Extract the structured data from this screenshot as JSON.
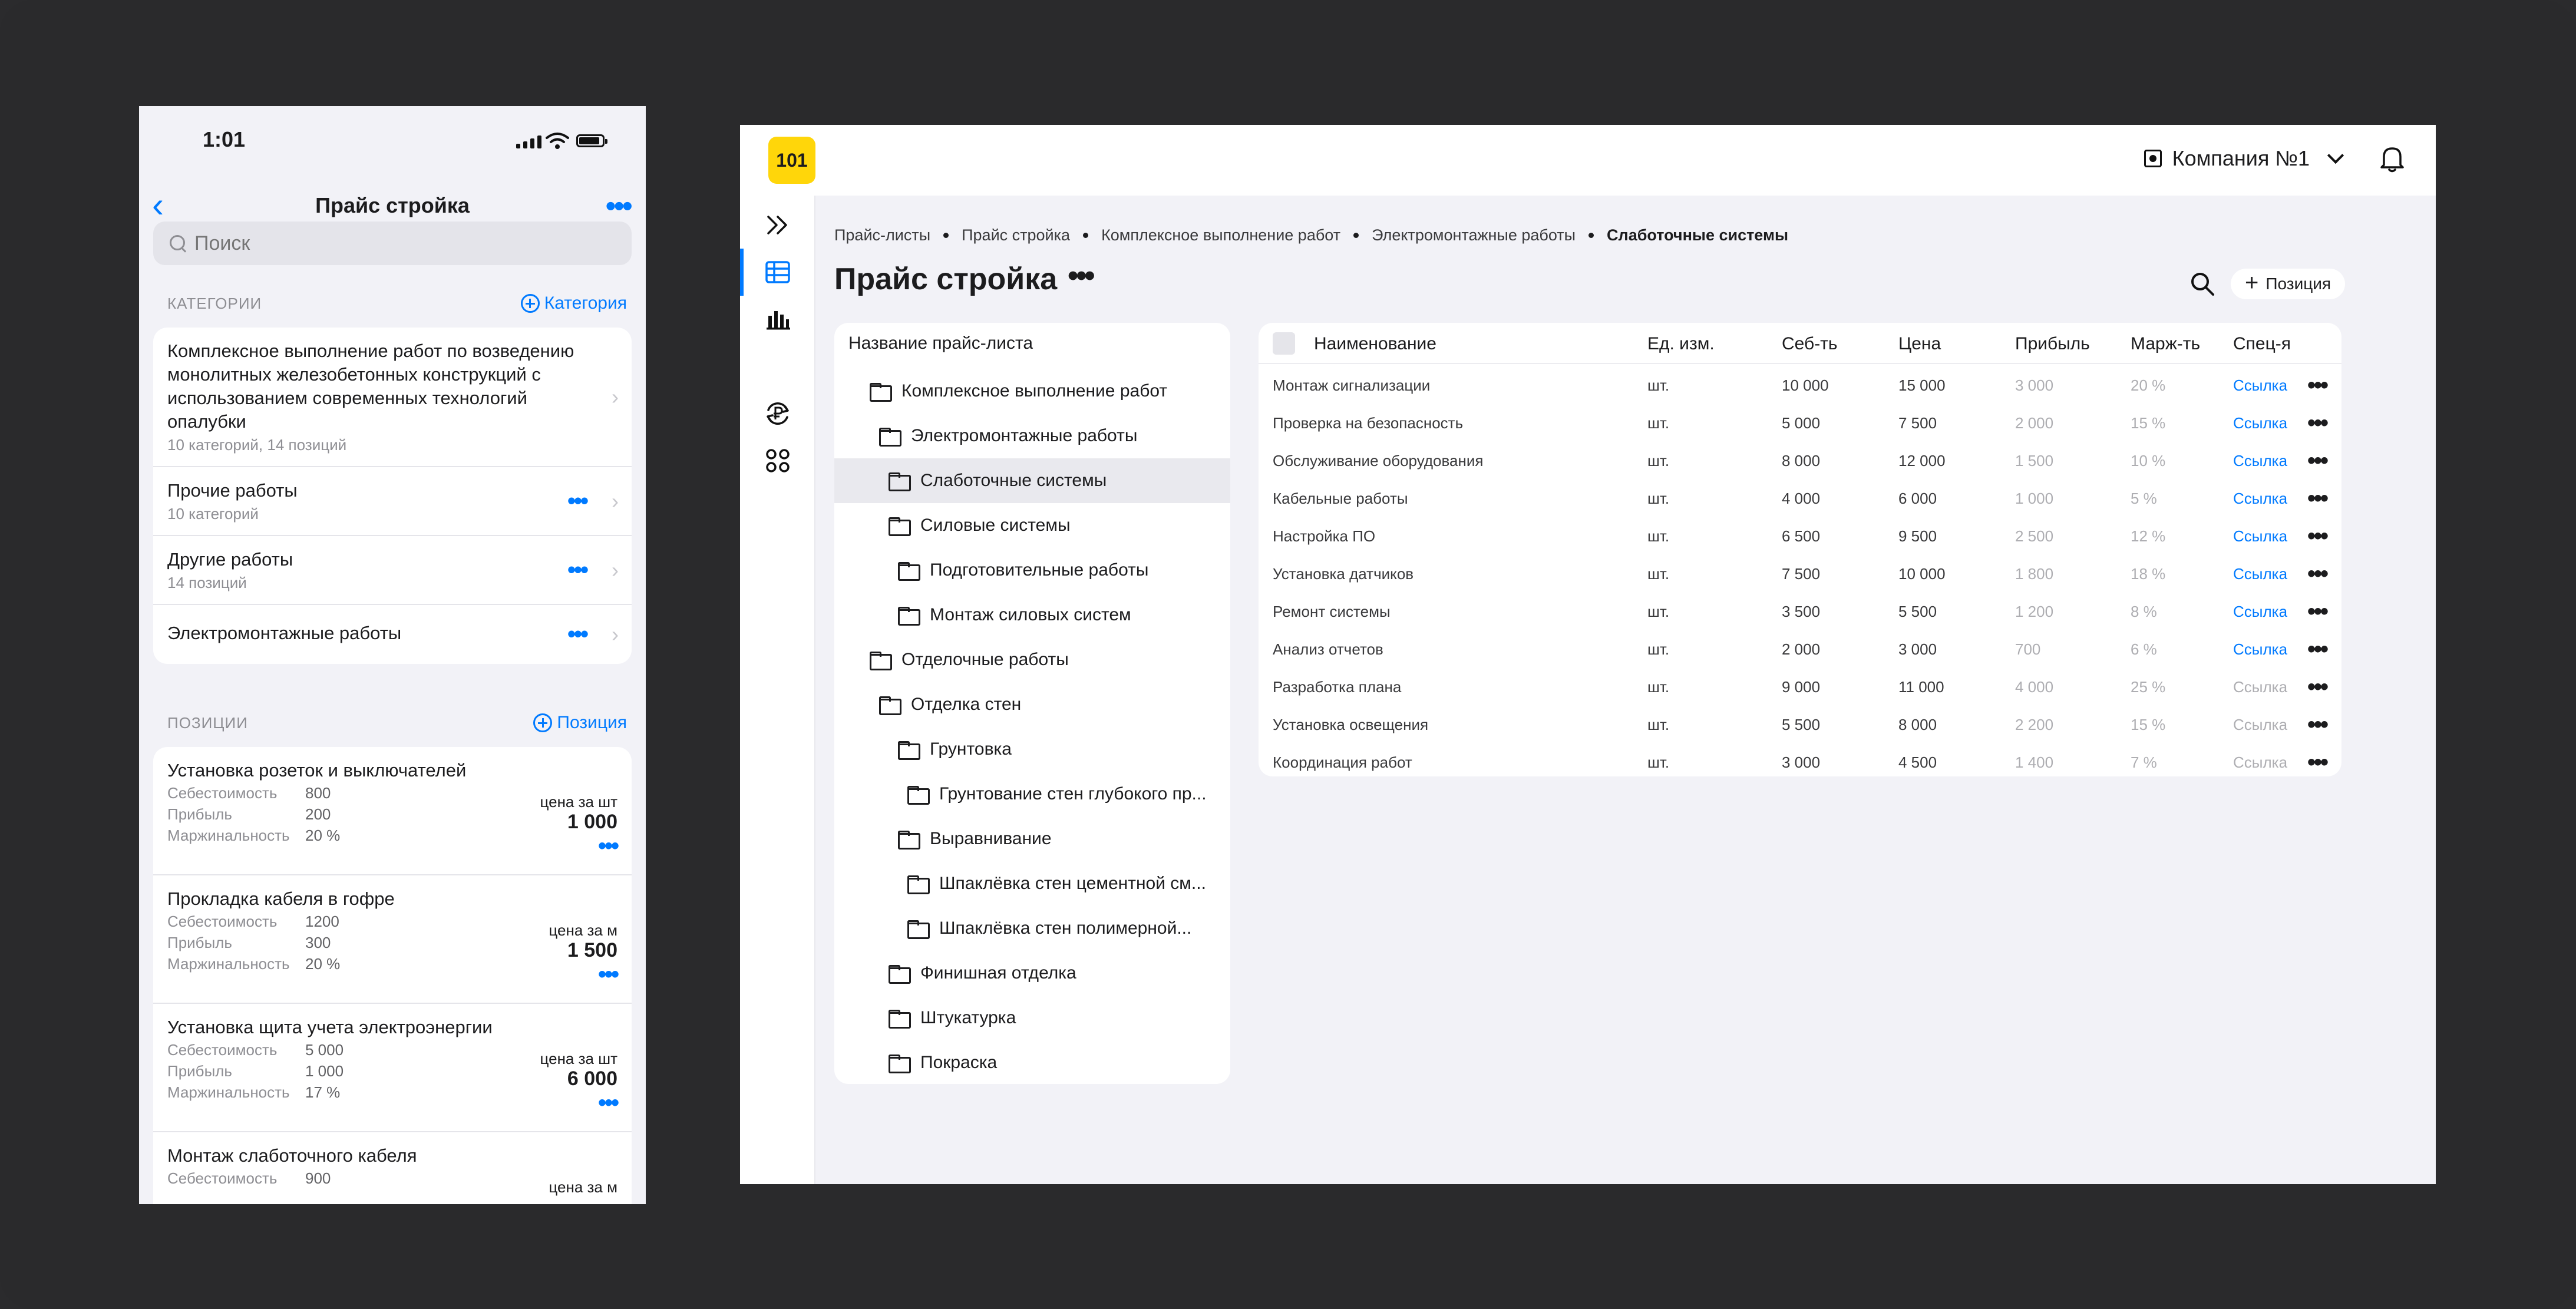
{
  "mobile": {
    "status": {
      "time": "1:01"
    },
    "nav": {
      "back": "‹",
      "title": "Прайс стройка",
      "more": "•••"
    },
    "search": {
      "placeholder": "Поиск"
    },
    "categories": {
      "label": "КАТЕГОРИИ",
      "add_label": "Категория",
      "items": [
        {
          "title": "Комплексное выполнение работ по возведению монолитных железобетонных конструкций с использованием современных технологий опалубки",
          "sub": "10 категорий, 14 позиций"
        },
        {
          "title": "Прочие работы",
          "sub": "10 категорий"
        },
        {
          "title": "Другие работы",
          "sub": "14 позиций"
        },
        {
          "title": "Электромонтажные работы",
          "sub": ""
        }
      ]
    },
    "positions": {
      "label": "ПОЗИЦИИ",
      "add_label": "Позиция",
      "cost_label": "Себестоимость",
      "profit_label": "Прибыль",
      "margin_label": "Маржинальность",
      "items": [
        {
          "title": "Установка розеток и выключателей",
          "cost": "800",
          "profit": "200",
          "margin": "20 %",
          "unit": "цена за шт",
          "price": "1 000"
        },
        {
          "title": "Прокладка кабеля в гофре",
          "cost": "1200",
          "profit": "300",
          "margin": "20 %",
          "unit": "цена за м",
          "price": "1 500"
        },
        {
          "title": "Установка щита учета электроэнергии",
          "cost": "5 000",
          "profit": "1 000",
          "margin": "17 %",
          "unit": "цена за шт",
          "price": "6 000"
        },
        {
          "title": "Монтаж слаботочного кабеля",
          "cost": "900",
          "profit": "",
          "margin": "",
          "unit": "цена за м",
          "price": ""
        }
      ]
    }
  },
  "desktop": {
    "logo": "101",
    "company": "Компания №1",
    "breadcrumbs": [
      "Прайс-листы",
      "Прайс стройка",
      "Комплексное выполнение работ",
      "Электромонтажные работы",
      "Слаботочные системы"
    ],
    "title": "Прайс стройка",
    "title_more": "•••",
    "add_position": "Позиция",
    "tree": {
      "header": "Название прайс-листа",
      "nodes": [
        {
          "label": "Комплексное выполнение работ",
          "level": 1,
          "selected": false
        },
        {
          "label": "Электромонтажные работы",
          "level": 2,
          "selected": false
        },
        {
          "label": "Слаботочные системы",
          "level": 3,
          "selected": true
        },
        {
          "label": "Силовые системы",
          "level": 3,
          "selected": false
        },
        {
          "label": "Подготовительные работы",
          "level": 4,
          "selected": false
        },
        {
          "label": "Монтаж силовых систем",
          "level": 4,
          "selected": false
        },
        {
          "label": "Отделочные работы",
          "level": 1,
          "selected": false
        },
        {
          "label": "Отделка стен",
          "level": 2,
          "selected": false
        },
        {
          "label": "Грунтовка",
          "level": 4,
          "selected": false
        },
        {
          "label": "Грунтование стен глубокого пр...",
          "level": 5,
          "selected": false
        },
        {
          "label": "Выравнивание",
          "level": 4,
          "selected": false
        },
        {
          "label": "Шпаклёвка стен цементной см...",
          "level": 5,
          "selected": false
        },
        {
          "label": "Шпаклёвка стен полимерной...",
          "level": 5,
          "selected": false
        },
        {
          "label": "Финишная отделка",
          "level": 3,
          "selected": false
        },
        {
          "label": "Штукатурка",
          "level": 3,
          "selected": false
        },
        {
          "label": "Покраска",
          "level": 3,
          "selected": false
        }
      ]
    },
    "table": {
      "columns": [
        "Наименование",
        "Ед. изм.",
        "Себ-ть",
        "Цена",
        "Прибыль",
        "Марж-ть",
        "Спец-я"
      ],
      "rows": [
        {
          "name": "Монтаж сигнализации",
          "unit": "шт.",
          "cost": "10 000",
          "price": "15 000",
          "profit": "3 000",
          "margin": "20 %",
          "spec": "Ссылка",
          "spec_active": true
        },
        {
          "name": "Проверка на безопасность",
          "unit": "шт.",
          "cost": "5 000",
          "price": "7 500",
          "profit": "2 000",
          "margin": "15 %",
          "spec": "Ссылка",
          "spec_active": true
        },
        {
          "name": "Обслуживание оборудования",
          "unit": "шт.",
          "cost": "8 000",
          "price": "12 000",
          "profit": "1 500",
          "margin": "10 %",
          "spec": "Ссылка",
          "spec_active": true
        },
        {
          "name": "Кабельные работы",
          "unit": "шт.",
          "cost": "4 000",
          "price": "6 000",
          "profit": "1 000",
          "margin": "5 %",
          "spec": "Ссылка",
          "spec_active": true
        },
        {
          "name": "Настройка ПО",
          "unit": "шт.",
          "cost": "6 500",
          "price": "9 500",
          "profit": "2 500",
          "margin": "12 %",
          "spec": "Ссылка",
          "spec_active": true
        },
        {
          "name": "Установка датчиков",
          "unit": "шт.",
          "cost": "7 500",
          "price": "10 000",
          "profit": "1 800",
          "margin": "18 %",
          "spec": "Ссылка",
          "spec_active": true
        },
        {
          "name": "Ремонт системы",
          "unit": "шт.",
          "cost": "3 500",
          "price": "5 500",
          "profit": "1 200",
          "margin": "8 %",
          "spec": "Ссылка",
          "spec_active": true
        },
        {
          "name": "Анализ отчетов",
          "unit": "шт.",
          "cost": "2 000",
          "price": "3 000",
          "profit": "700",
          "margin": "6 %",
          "spec": "Ссылка",
          "spec_active": true
        },
        {
          "name": "Разработка плана",
          "unit": "шт.",
          "cost": "9 000",
          "price": "11 000",
          "profit": "4 000",
          "margin": "25 %",
          "spec": "Ссылка",
          "spec_active": false
        },
        {
          "name": "Установка освещения",
          "unit": "шт.",
          "cost": "5 500",
          "price": "8 000",
          "profit": "2 200",
          "margin": "15 %",
          "spec": "Ссылка",
          "spec_active": false
        },
        {
          "name": "Координация работ",
          "unit": "шт.",
          "cost": "3 000",
          "price": "4 500",
          "profit": "1 400",
          "margin": "7 %",
          "spec": "Ссылка",
          "spec_active": false
        }
      ],
      "row_more": "•••"
    },
    "sidebar_icons": [
      "expand-icon",
      "table-icon",
      "chart-icon",
      "ruble-exchange-icon",
      "apps-icon"
    ]
  },
  "colors": {
    "accent": "#007aff",
    "logo_bg": "#ffd60a",
    "background": "#2a2a2c",
    "muted": "#aeaeb2"
  }
}
